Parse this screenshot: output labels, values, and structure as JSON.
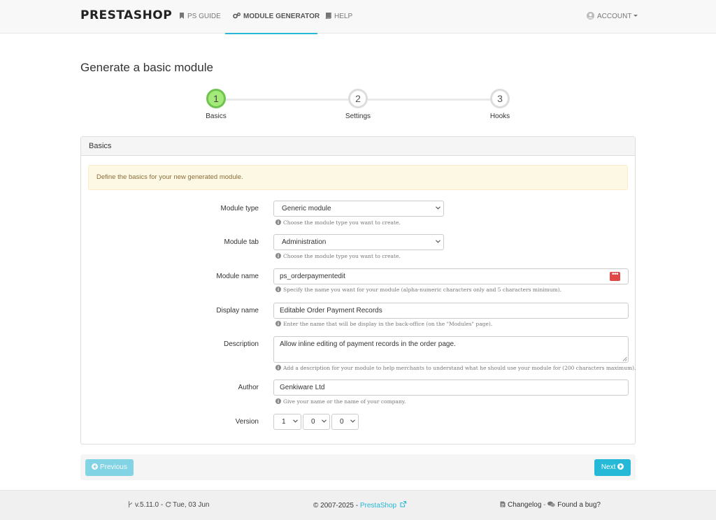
{
  "navbar": {
    "brand": "PRESTASHOP",
    "items": [
      {
        "label": "PS GUIDE",
        "icon": "bookmark-icon"
      },
      {
        "label": "MODULE GENERATOR",
        "icon": "cogs-icon",
        "active": true
      },
      {
        "label": "HELP",
        "icon": "book-icon"
      }
    ],
    "account_label": "ACCOUNT"
  },
  "page": {
    "title": "Generate a basic module"
  },
  "stepper": {
    "steps": [
      {
        "number": "1",
        "label": "Basics",
        "active": true
      },
      {
        "number": "2",
        "label": "Settings"
      },
      {
        "number": "3",
        "label": "Hooks"
      }
    ]
  },
  "panel": {
    "heading": "Basics",
    "alert": "Define the basics for your new generated module.",
    "fields": {
      "module_type": {
        "label": "Module type",
        "value": "Generic module",
        "help": "Choose the module type you want to create."
      },
      "module_tab": {
        "label": "Module tab",
        "value": "Administration",
        "help": "Choose the module type you want to create."
      },
      "module_name": {
        "label": "Module name",
        "value": "ps_orderpaymentedit",
        "help": "Specify the name you want for your module (alpha-numeric characters only and 5 characters minimum)."
      },
      "display_name": {
        "label": "Display name",
        "value": "Editable Order Payment Records",
        "help": "Enter the name that will be display in the back-office (on the \"Modules\" page)."
      },
      "description": {
        "label": "Description",
        "value": "Allow inline editing of payment records in the order page.",
        "help": "Add a description for your module to help merchants to understand what he should use your module for (200 characters maximum)."
      },
      "author": {
        "label": "Author",
        "value": "Genkiware Ltd",
        "help": "Give your name or the name of your company."
      },
      "version": {
        "label": "Version",
        "major": "1",
        "minor": "0",
        "patch": "0"
      }
    }
  },
  "pager": {
    "previous_label": "Previous",
    "next_label": "Next"
  },
  "footer": {
    "version": "v.5.11.0",
    "date": "Tue, 03 Jun",
    "copyright": "© 2007-2025 - ",
    "copyright_link": "PrestaShop",
    "changelog": "Changelog",
    "separator": " - ",
    "bug": "Found a bug?"
  },
  "colors": {
    "accent": "#25b9d7",
    "step_active": "#a4ea7a",
    "alert_bg": "#fcf8e3",
    "alert_text": "#8a6d3b",
    "danger": "#e04848"
  }
}
